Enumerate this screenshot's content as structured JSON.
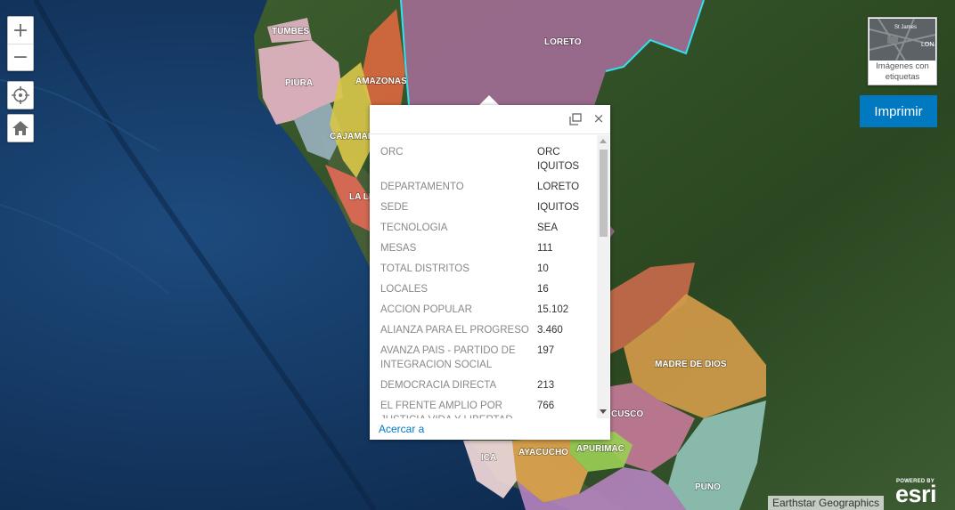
{
  "map": {
    "regions": [
      {
        "id": "loreto",
        "label": "LORETO"
      },
      {
        "id": "tumbes",
        "label": "TUMBES"
      },
      {
        "id": "piura",
        "label": "PIURA"
      },
      {
        "id": "amazonas",
        "label": "AMAZONAS"
      },
      {
        "id": "cajamarca",
        "label": "CAJAMAR"
      },
      {
        "id": "la-libertad",
        "label": "LA LI"
      },
      {
        "id": "madre-de-dios",
        "label": "MADRE DE DIOS"
      },
      {
        "id": "cusco",
        "label": "CUSCO"
      },
      {
        "id": "apurimac",
        "label": "APURIMAC"
      },
      {
        "id": "ayacucho",
        "label": "AYACUCHO"
      },
      {
        "id": "ica",
        "label": "ICA"
      },
      {
        "id": "puno",
        "label": "PUNO"
      }
    ],
    "colors": {
      "loreto": "#a06b93",
      "piura": "#e8b7c8",
      "amazonas": "#d9673e",
      "cajamarca": "#d7c64a",
      "madre_de_dios": "#d19a4a",
      "cusco": "#c77b9a",
      "puno": "#8fc2b6",
      "ayacucho": "#dfa44e",
      "apurimac": "#9acd55",
      "ocean": "#163d6b",
      "jungle": "#2f4d26"
    }
  },
  "controls": {
    "zoom_in": "+",
    "zoom_out": "−",
    "locate_icon": "locate-icon",
    "home_icon": "home-icon"
  },
  "basemap": {
    "thumb_text_1": "St James",
    "thumb_text_2": "LON",
    "label": "Imágenes con etiquetas"
  },
  "print_button": "Imprimir",
  "popup": {
    "close": "×",
    "rows": [
      {
        "key": "ORC",
        "value": "ORC IQUITOS"
      },
      {
        "key": "DEPARTAMENTO",
        "value": "LORETO"
      },
      {
        "key": "SEDE",
        "value": "IQUITOS"
      },
      {
        "key": "TECNOLOGIA",
        "value": "SEA"
      },
      {
        "key": "MESAS",
        "value": "111"
      },
      {
        "key": "TOTAL DISTRITOS",
        "value": "10"
      },
      {
        "key": "LOCALES",
        "value": "16"
      },
      {
        "key": "ACCION POPULAR",
        "value": "15.102"
      },
      {
        "key": "ALIANZA PARA EL PROGRESO",
        "value": "3.460"
      },
      {
        "key": "AVANZA PAIS - PARTIDO DE INTEGRACION SOCIAL",
        "value": "197"
      },
      {
        "key": "DEMOCRACIA DIRECTA",
        "value": "213"
      },
      {
        "key": "EL FRENTE AMPLIO POR JUSTICIA VIDA Y LIBERTAD",
        "value": "766"
      }
    ],
    "zoom_link": "Acercar a"
  },
  "attribution": "Earthstar Geographics",
  "esri": {
    "powered": "POWERED BY",
    "word": "esri"
  }
}
